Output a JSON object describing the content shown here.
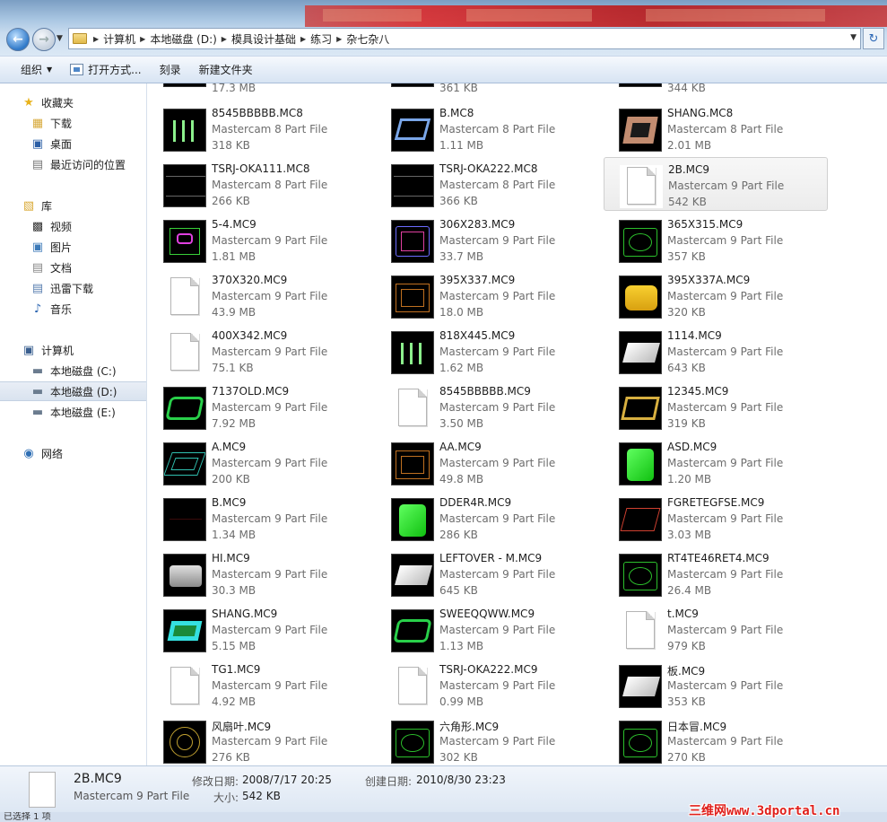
{
  "address": {
    "crumbs": [
      "计算机",
      "本地磁盘 (D:)",
      "模具设计基础",
      "练习",
      "杂七杂八"
    ]
  },
  "toolbar": {
    "organize": "组织",
    "open_with": "打开方式...",
    "burn": "刻录",
    "new_folder": "新建文件夹"
  },
  "navpane": {
    "favorites": "收藏夹",
    "downloads": "下载",
    "desktop": "桌面",
    "recent": "最近访问的位置",
    "libraries": "库",
    "videos": "视频",
    "pictures": "图片",
    "documents": "文档",
    "thunder": "迅雷下载",
    "music": "音乐",
    "computer": "计算机",
    "drive_c": "本地磁盘 (C:)",
    "drive_d": "本地磁盘 (D:)",
    "drive_e": "本地磁盘 (E:)",
    "network": "网络"
  },
  "partial_sizes": [
    "17.3 MB",
    "361 KB",
    "344 KB"
  ],
  "files": [
    {
      "name": "8545BBBBB.MC8",
      "type": "Mastercam 8 Part File",
      "size": "318 KB",
      "thumb": "bars"
    },
    {
      "name": "B.MC8",
      "type": "Mastercam 8 Part File",
      "size": "1.11 MB",
      "thumb": "frame-blue"
    },
    {
      "name": "SHANG.MC8",
      "type": "Mastercam 8 Part File",
      "size": "2.01 MB",
      "thumb": "frame-tan"
    },
    {
      "name": "TSRJ-OKA111.MC8",
      "type": "Mastercam 8 Part File",
      "size": "266 KB",
      "thumb": "lines"
    },
    {
      "name": "TSRJ-OKA222.MC8",
      "type": "Mastercam 8 Part File",
      "size": "366 KB",
      "thumb": "lines"
    },
    {
      "name": "2B.MC9",
      "type": "Mastercam 9 Part File",
      "size": "542 KB",
      "thumb": "blank"
    },
    {
      "name": "5-4.MC9",
      "type": "Mastercam 9 Part File",
      "size": "1.81 MB",
      "thumb": "wire-multi"
    },
    {
      "name": "306X283.MC9",
      "type": "Mastercam 9 Part File",
      "size": "33.7 MB",
      "thumb": "wire-blue"
    },
    {
      "name": "365X315.MC9",
      "type": "Mastercam 9 Part File",
      "size": "357 KB",
      "thumb": "wire-green"
    },
    {
      "name": "370X320.MC9",
      "type": "Mastercam 9 Part File",
      "size": "43.9 MB",
      "thumb": "blank"
    },
    {
      "name": "395X337.MC9",
      "type": "Mastercam 9 Part File",
      "size": "18.0 MB",
      "thumb": "wire-orange"
    },
    {
      "name": "395X337A.MC9",
      "type": "Mastercam 9 Part File",
      "size": "320 KB",
      "thumb": "solid-yellow"
    },
    {
      "name": "400X342.MC9",
      "type": "Mastercam 9 Part File",
      "size": "75.1 KB",
      "thumb": "blank"
    },
    {
      "name": "818X445.MC9",
      "type": "Mastercam 9 Part File",
      "size": "1.62 MB",
      "thumb": "bars"
    },
    {
      "name": "1114.MC9",
      "type": "Mastercam 9 Part File",
      "size": "643 KB",
      "thumb": "solid-white"
    },
    {
      "name": "7137OLD.MC9",
      "type": "Mastercam 9 Part File",
      "size": "7.92 MB",
      "thumb": "frame-green"
    },
    {
      "name": "8545BBBBB.MC9",
      "type": "Mastercam 9 Part File",
      "size": "3.50 MB",
      "thumb": "blank"
    },
    {
      "name": "12345.MC9",
      "type": "Mastercam 9 Part File",
      "size": "319 KB",
      "thumb": "frame-gold"
    },
    {
      "name": "A.MC9",
      "type": "Mastercam 9 Part File",
      "size": "200 KB",
      "thumb": "wire-cyan"
    },
    {
      "name": "AA.MC9",
      "type": "Mastercam 9 Part File",
      "size": "49.8 MB",
      "thumb": "wire-orange"
    },
    {
      "name": "ASD.MC9",
      "type": "Mastercam 9 Part File",
      "size": "1.20 MB",
      "thumb": "solid-green"
    },
    {
      "name": "B.MC9",
      "type": "Mastercam 9 Part File",
      "size": "1.34 MB",
      "thumb": "dark"
    },
    {
      "name": "DDER4R.MC9",
      "type": "Mastercam 9 Part File",
      "size": "286 KB",
      "thumb": "solid-green"
    },
    {
      "name": "FGRETEGFSE.MC9",
      "type": "Mastercam 9 Part File",
      "size": "3.03 MB",
      "thumb": "wire-red"
    },
    {
      "name": "HI.MC9",
      "type": "Mastercam 9 Part File",
      "size": "30.3 MB",
      "thumb": "solid-grey"
    },
    {
      "name": "LEFTOVER - M.MC9",
      "type": "Mastercam 9 Part File",
      "size": "645 KB",
      "thumb": "solid-white"
    },
    {
      "name": "RT4TE46RET4.MC9",
      "type": "Mastercam 9 Part File",
      "size": "26.4 MB",
      "thumb": "wire-green"
    },
    {
      "name": "SHANG.MC9",
      "type": "Mastercam 9 Part File",
      "size": "5.15 MB",
      "thumb": "frame-cyan"
    },
    {
      "name": "SWEEQQWW.MC9",
      "type": "Mastercam 9 Part File",
      "size": "1.13 MB",
      "thumb": "frame-green"
    },
    {
      "name": "t.MC9",
      "type": "Mastercam 9 Part File",
      "size": "979 KB",
      "thumb": "blank"
    },
    {
      "name": "TG1.MC9",
      "type": "Mastercam 9 Part File",
      "size": "4.92 MB",
      "thumb": "blank"
    },
    {
      "name": "TSRJ-OKA222.MC9",
      "type": "Mastercam 9 Part File",
      "size": "0.99 MB",
      "thumb": "blank"
    },
    {
      "name": "板.MC9",
      "type": "Mastercam 9 Part File",
      "size": "353 KB",
      "thumb": "solid-white"
    },
    {
      "name": "风扇叶.MC9",
      "type": "Mastercam 9 Part File",
      "size": "276 KB",
      "thumb": "wire-gold"
    },
    {
      "name": "六角形.MC9",
      "type": "Mastercam 9 Part File",
      "size": "302 KB",
      "thumb": "wire-green"
    },
    {
      "name": "日本冒.MC9",
      "type": "Mastercam 9 Part File",
      "size": "270 KB",
      "thumb": "wire-green"
    }
  ],
  "selected_index": 5,
  "details": {
    "name": "2B.MC9",
    "type": "Mastercam 9 Part File",
    "modified_label": "修改日期:",
    "modified_value": "2008/7/17 20:25",
    "created_label": "创建日期:",
    "created_value": "2010/8/30 23:23",
    "size_label": "大小:",
    "size_value": "542 KB"
  },
  "status": "已选择 1 项",
  "watermark": "三维网www.3dportal.cn"
}
